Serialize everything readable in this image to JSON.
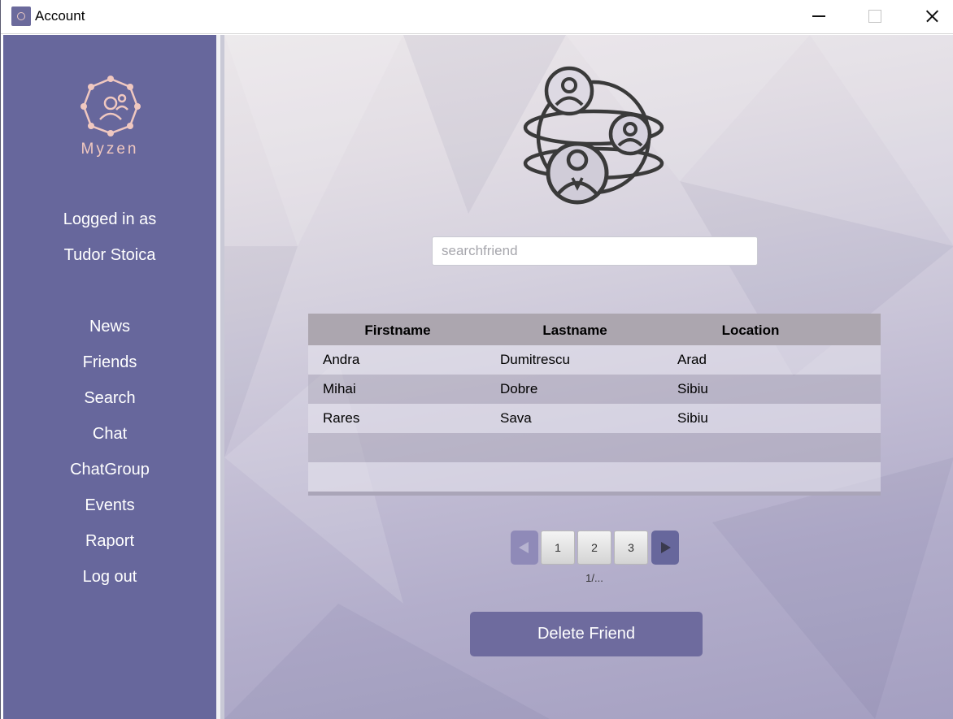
{
  "window": {
    "title": "Account"
  },
  "sidebar": {
    "brand": "Myzen",
    "logged_in_label": "Logged in as",
    "user_name": "Tudor Stoica",
    "nav": [
      "News",
      "Friends",
      "Search",
      "Chat",
      "ChatGroup",
      "Events",
      "Raport",
      "Log out"
    ]
  },
  "main": {
    "search_placeholder": "searchfriend",
    "table": {
      "columns": [
        "Firstname",
        "Lastname",
        "Location"
      ],
      "rows": [
        [
          "Andra",
          "Dumitrescu",
          "Arad"
        ],
        [
          "Mihai",
          "Dobre",
          "Sibiu"
        ],
        [
          "Rares",
          "Sava",
          "Sibiu"
        ]
      ]
    },
    "pagination": {
      "pages": [
        "1",
        "2",
        "3"
      ],
      "info": "1/..."
    },
    "delete_label": "Delete Friend"
  },
  "colors": {
    "sidebar": "#67679c",
    "accent_text": "#f0c8c0",
    "button": "#6e6b9e"
  },
  "icons": [
    "app-icon",
    "minimize-icon",
    "maximize-icon",
    "close-icon",
    "myzen-logo-icon",
    "friends-globe-icon",
    "prev-page-icon",
    "next-page-icon"
  ]
}
